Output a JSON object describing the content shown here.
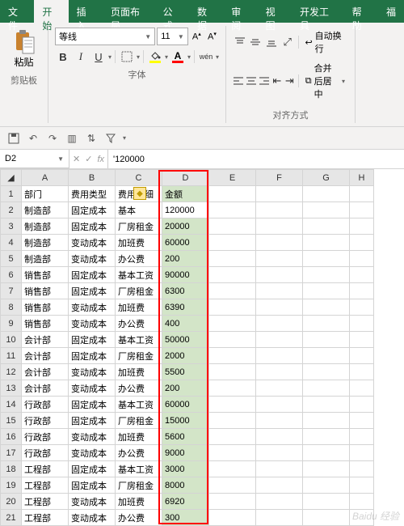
{
  "ribbon": {
    "tabs": [
      "文件",
      "开始",
      "插入",
      "页面布局",
      "公式",
      "数据",
      "审阅",
      "视图",
      "开发工具",
      "帮助",
      "福"
    ],
    "active_tab": "开始",
    "clipboard": {
      "paste": "粘贴",
      "label": "剪贴板"
    },
    "font": {
      "name": "等线",
      "size": "11",
      "label": "字体",
      "bold": "B",
      "italic": "I",
      "underline": "U",
      "wen": "wén"
    },
    "align": {
      "wrap": "自动换行",
      "merge": "合并后居中",
      "label": "对齐方式"
    }
  },
  "formula_bar": {
    "name_box": "D2",
    "fx": "fx",
    "value": "'120000"
  },
  "columns": [
    "A",
    "B",
    "C",
    "D",
    "E",
    "F",
    "G",
    "H"
  ],
  "headers": {
    "A": "部门",
    "B": "费用类型",
    "C": "费用明细",
    "D": "金额"
  },
  "rows": [
    {
      "n": 2,
      "a": "制造部",
      "b": "固定成本",
      "c": "基本",
      "d": "120000"
    },
    {
      "n": 3,
      "a": "制造部",
      "b": "固定成本",
      "c": "厂房租金",
      "d": "20000"
    },
    {
      "n": 4,
      "a": "制造部",
      "b": "变动成本",
      "c": "加班费",
      "d": "60000"
    },
    {
      "n": 5,
      "a": "制造部",
      "b": "变动成本",
      "c": "办公费",
      "d": "200"
    },
    {
      "n": 6,
      "a": "销售部",
      "b": "固定成本",
      "c": "基本工资",
      "d": "90000"
    },
    {
      "n": 7,
      "a": "销售部",
      "b": "固定成本",
      "c": "厂房租金",
      "d": "6300"
    },
    {
      "n": 8,
      "a": "销售部",
      "b": "变动成本",
      "c": "加班费",
      "d": "6390"
    },
    {
      "n": 9,
      "a": "销售部",
      "b": "变动成本",
      "c": "办公费",
      "d": "400"
    },
    {
      "n": 10,
      "a": "会计部",
      "b": "固定成本",
      "c": "基本工资",
      "d": "50000"
    },
    {
      "n": 11,
      "a": "会计部",
      "b": "固定成本",
      "c": "厂房租金",
      "d": "2000"
    },
    {
      "n": 12,
      "a": "会计部",
      "b": "变动成本",
      "c": "加班费",
      "d": "5500"
    },
    {
      "n": 13,
      "a": "会计部",
      "b": "变动成本",
      "c": "办公费",
      "d": "200"
    },
    {
      "n": 14,
      "a": "行政部",
      "b": "固定成本",
      "c": "基本工资",
      "d": "60000"
    },
    {
      "n": 15,
      "a": "行政部",
      "b": "固定成本",
      "c": "厂房租金",
      "d": "15000"
    },
    {
      "n": 16,
      "a": "行政部",
      "b": "变动成本",
      "c": "加班费",
      "d": "5600"
    },
    {
      "n": 17,
      "a": "行政部",
      "b": "变动成本",
      "c": "办公费",
      "d": "9000"
    },
    {
      "n": 18,
      "a": "工程部",
      "b": "固定成本",
      "c": "基本工资",
      "d": "3000"
    },
    {
      "n": 19,
      "a": "工程部",
      "b": "固定成本",
      "c": "厂房租金",
      "d": "8000"
    },
    {
      "n": 20,
      "a": "工程部",
      "b": "变动成本",
      "c": "加班费",
      "d": "6920"
    },
    {
      "n": 21,
      "a": "工程部",
      "b": "变动成本",
      "c": "办公费",
      "d": "300"
    }
  ],
  "colors": {
    "fill": "#ffff00",
    "font": "#ff0000"
  },
  "watermark": "Baidu 经验"
}
